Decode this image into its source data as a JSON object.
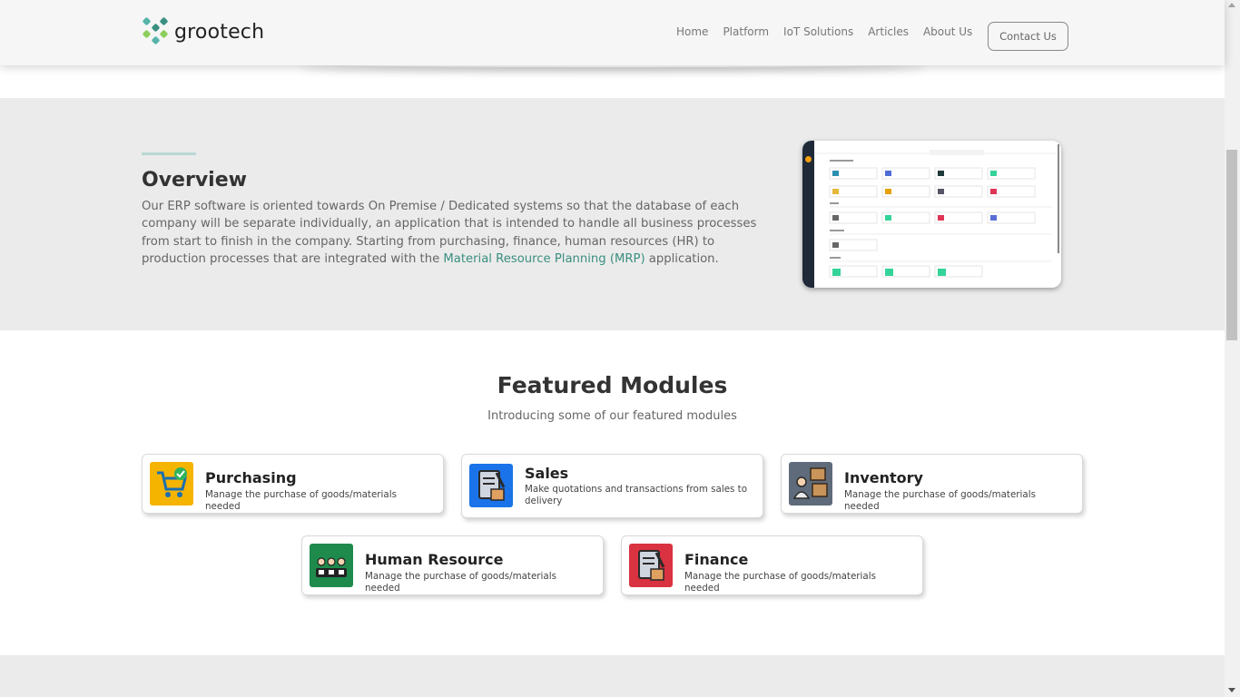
{
  "brand": {
    "name": "grootech"
  },
  "nav": {
    "items": [
      "Home",
      "Platform",
      "IoT Solutions",
      "Articles",
      "About Us"
    ],
    "contact_label": "Contact Us"
  },
  "overview": {
    "title": "Overview",
    "text_before_link": "Our ERP software is oriented towards On Premise / Dedicated systems so that the database of each company will be separate individually, an application that is intended to handle all business processes from start to finish in the company. Starting from purchasing, finance, human resources (HR) to production processes that are integrated with the ",
    "link_text": "Material Resource Planning (MRP)",
    "text_after_link": " application."
  },
  "featured": {
    "title": "Featured Modules",
    "subtitle": "Introducing some of our featured modules",
    "modules": [
      {
        "title": "Purchasing",
        "description": "Manage the purchase of goods/materials needed",
        "icon": "shopping-cart-icon",
        "color": "#f5b400"
      },
      {
        "title": "Sales",
        "description": "Make quotations and transactions from sales to delivery",
        "icon": "sales-clipboard-icon",
        "color": "#1a73e8"
      },
      {
        "title": "Inventory",
        "description": "Manage the purchase of goods/materials needed",
        "icon": "inventory-boxes-icon",
        "color": "#5f6b7a"
      },
      {
        "title": "Human Resource",
        "description": "Manage the purchase of goods/materials needed",
        "icon": "team-icon",
        "color": "#1e8a4c"
      },
      {
        "title": "Finance",
        "description": "Manage the purchase of goods/materials needed",
        "icon": "finance-clipboard-icon",
        "color": "#d93240"
      }
    ]
  },
  "colors": {
    "accent": "#3a8f80",
    "header_bg": "#f6f6f6",
    "section_bg": "#ebebeb"
  }
}
